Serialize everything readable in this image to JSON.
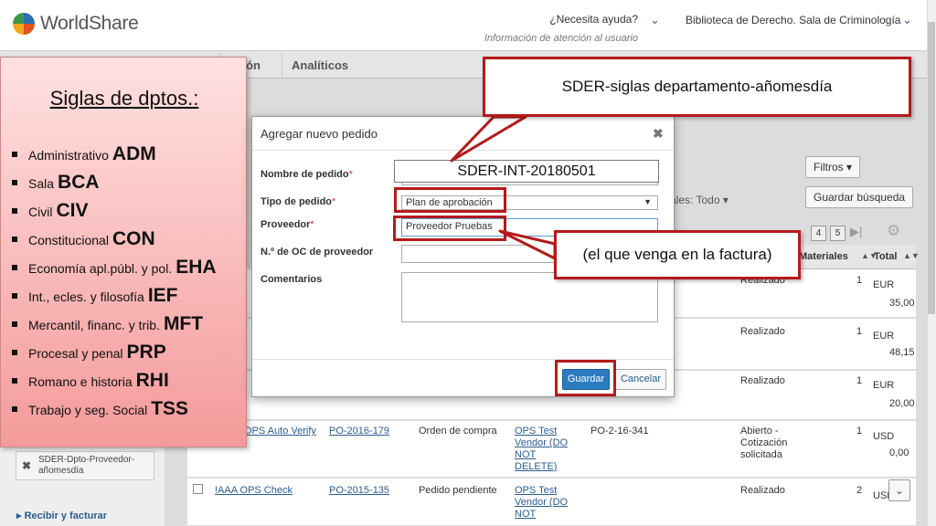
{
  "header": {
    "brand": "WorldShare",
    "help_question": "¿Necesita ayuda?",
    "help_subtitle": "Información de atención al usuario",
    "library_name": "Biblioteca de Derecho. Sala de Criminología"
  },
  "nav": {
    "tabs": [
      "ación",
      "Analíticos"
    ]
  },
  "toolbar": {
    "filters_label": "Filtros",
    "save_search_label": "Guardar búsqueda",
    "materials_filter": "ales: Todo",
    "pages": [
      "4",
      "5"
    ]
  },
  "table": {
    "columns": [
      "Materiales",
      "Total"
    ],
    "rows": [
      {
        "status": "Realizado",
        "materials": "1",
        "currency": "EUR",
        "total": "35,00"
      },
      {
        "status": "Realizado",
        "materials": "1",
        "currency": "EUR",
        "total": "48,15"
      },
      {
        "status": "Realizado",
        "materials": "1",
        "currency": "EUR",
        "total": "20,00"
      },
      {
        "name": "OPS Auto Verify",
        "number": "PO-2016-179",
        "type": "Orden de compra",
        "vendor": "OPS Test Vendor (DO NOT DELETE)",
        "vendor_po": "PO-2-16-341",
        "status": "Abierto - Cotización solicitada",
        "materials": "1",
        "currency": "USD",
        "total": "0,00"
      },
      {
        "name": "!AAA OPS Check",
        "number": "PO-2015-135",
        "type": "Pedido pendiente",
        "vendor": "OPS Test Vendor (DO NOT",
        "status": "Realizado",
        "materials": "2",
        "currency": "USD",
        "total": ""
      }
    ]
  },
  "sidebar": {
    "chip_label": "SDER-Dpto-Proveedor-añomesdía",
    "receive_invoice": "Recibir y facturar"
  },
  "note": {
    "title": "Siglas de dptos.:",
    "items": [
      {
        "label": "Administrativo",
        "abbr": "ADM"
      },
      {
        "label": "Sala",
        "abbr": "BCA"
      },
      {
        "label": "Civil",
        "abbr": "CIV"
      },
      {
        "label": "Constitucional",
        "abbr": "CON"
      },
      {
        "label": "Economía apl.públ. y pol.",
        "abbr": "EHA"
      },
      {
        "label": "Int., ecles. y filosofía",
        "abbr": "IEF"
      },
      {
        "label": "Mercantil, financ. y trib.",
        "abbr": "MFT"
      },
      {
        "label": "Procesal y penal",
        "abbr": "PRP"
      },
      {
        "label": "Romano e historia",
        "abbr": "RHI"
      },
      {
        "label": "Trabajo y seg. Social",
        "abbr": "TSS"
      }
    ]
  },
  "modal": {
    "title": "Agregar nuevo pedido",
    "order_name_label": "Nombre de pedido",
    "order_name_value": "SDER-INT-20180501",
    "order_type_label": "Tipo de pedido",
    "order_type_value": "Plan de aprobación",
    "vendor_label": "Proveedor",
    "vendor_value": "Proveedor Pruebas",
    "vendor_po_label": "N.º de OC de proveedor",
    "comments_label": "Comentarios",
    "save_label": "Guardar",
    "cancel_label": "Cancelar",
    "required_mark": "*"
  },
  "callouts": {
    "naming": "SDER-siglas departamento-añomesdía",
    "vendor_hint": "(el que venga en la factura)"
  },
  "colors": {
    "highlight": "#b51a1a",
    "primary_button": "#2c7bc1",
    "link": "#2a5d8f"
  }
}
